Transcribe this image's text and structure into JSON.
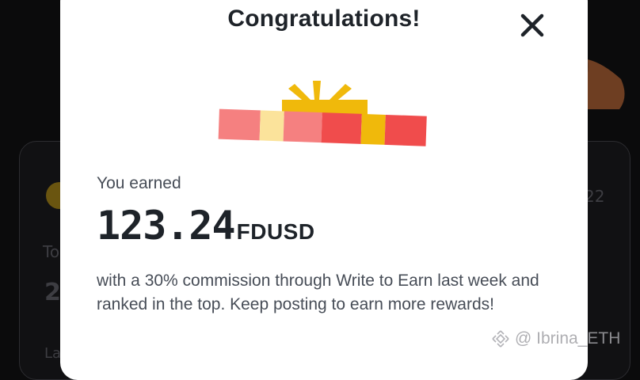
{
  "background": {
    "partial_label_1": "To",
    "partial_value": "2",
    "partial_label_2": "La",
    "partial_date": "22"
  },
  "modal": {
    "title": "Congratulations!",
    "close_icon": "close-icon",
    "gift_icon": "gift-box-icon",
    "earned_label": "You earned",
    "amount": "123.24",
    "currency": "FDUSD",
    "message": "with a 30% commission through Write to Earn last week and ranked in the top. Keep posting to earn more rewards!"
  },
  "watermark": {
    "logo_icon": "binance-logo-icon",
    "text": "@ Ibrina_ETH"
  },
  "colors": {
    "gift_red": "#f04c4c",
    "gift_pink": "#f58080",
    "gift_gold": "#f0b90b",
    "gift_cream": "#fbe39b",
    "text_primary": "#1e2329",
    "text_secondary": "#474d57"
  }
}
